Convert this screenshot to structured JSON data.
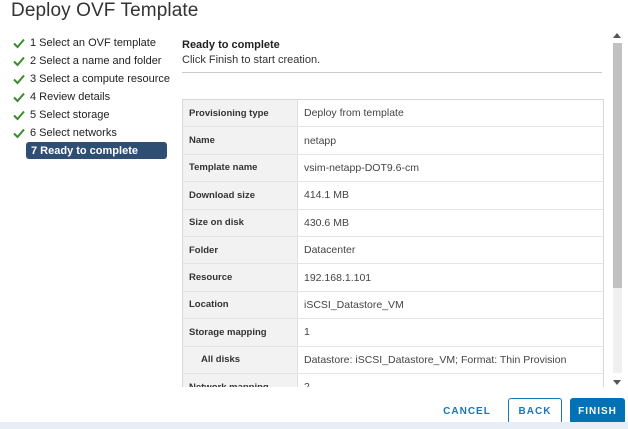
{
  "dialog": {
    "title": "Deploy OVF Template"
  },
  "steps": [
    {
      "label": "1 Select an OVF template",
      "done": true
    },
    {
      "label": "2 Select a name and folder",
      "done": true
    },
    {
      "label": "3 Select a compute resource",
      "done": true
    },
    {
      "label": "4 Review details",
      "done": true
    },
    {
      "label": "5 Select storage",
      "done": true
    },
    {
      "label": "6 Select networks",
      "done": true
    },
    {
      "label": "7 Ready to complete",
      "done": false,
      "active": true
    }
  ],
  "main": {
    "heading": "Ready to complete",
    "subheading": "Click Finish to start creation."
  },
  "summary": [
    {
      "key": "Provisioning type",
      "value": "Deploy from template"
    },
    {
      "key": "Name",
      "value": "netapp"
    },
    {
      "key": "Template name",
      "value": "vsim-netapp-DOT9.6-cm"
    },
    {
      "key": "Download size",
      "value": "414.1 MB"
    },
    {
      "key": "Size on disk",
      "value": "430.6 MB"
    },
    {
      "key": "Folder",
      "value": "Datacenter"
    },
    {
      "key": "Resource",
      "value": "192.168.1.101"
    },
    {
      "key": "Location",
      "value": "iSCSI_Datastore_VM"
    },
    {
      "key": "Storage mapping",
      "value": "1"
    },
    {
      "key": "All disks",
      "value": "Datastore: iSCSI_Datastore_VM; Format: Thin Provision"
    },
    {
      "key": "Network mapping",
      "value": "2"
    }
  ],
  "footer": {
    "cancel_label": "CANCEL",
    "back_label": "BACK",
    "finish_label": "FINISH"
  },
  "colors": {
    "accent": "#0072b5",
    "active_step_bg": "#2f4e73",
    "check_green": "#3a8b2a"
  }
}
